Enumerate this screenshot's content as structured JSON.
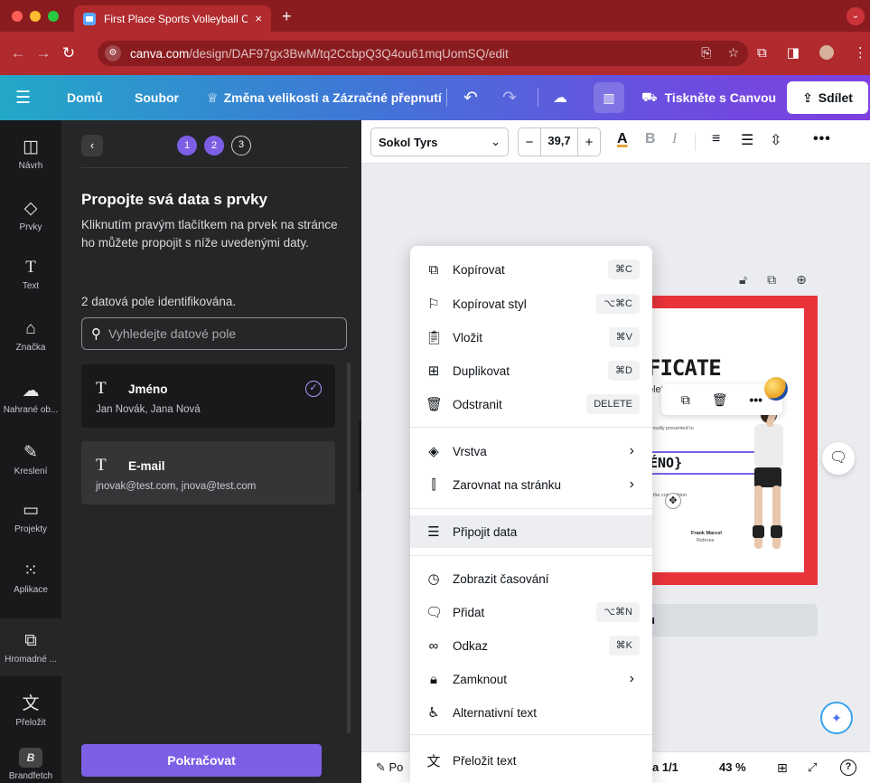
{
  "browser": {
    "tab_title": "First Place Sports Volleyball C",
    "tab_close": "×",
    "new_tab": "+",
    "url_host": "canva.com",
    "url_path": "/design/DAF97gx3BwM/tq2CcbpQ3Q4ou61mqUomSQ/edit"
  },
  "header": {
    "home": "Domů",
    "file": "Soubor",
    "resize": "Změna velikosti a Zázračné přepnutí",
    "print": "Tiskněte s Canvou",
    "share": "Sdílet"
  },
  "rail": [
    {
      "label": "Návrh",
      "icon": "layout-icon"
    },
    {
      "label": "Prvky",
      "icon": "shapes-icon"
    },
    {
      "label": "Text",
      "icon": "text-icon"
    },
    {
      "label": "Značka",
      "icon": "brand-icon"
    },
    {
      "label": "Nahrané ob...",
      "icon": "upload-icon"
    },
    {
      "label": "Kreslení",
      "icon": "draw-icon"
    },
    {
      "label": "Projekty",
      "icon": "folder-icon"
    },
    {
      "label": "Aplikace",
      "icon": "apps-icon"
    },
    {
      "label": "Hromadné ...",
      "icon": "bulk-create-icon"
    },
    {
      "label": "Přeložit",
      "icon": "translate-icon"
    },
    {
      "label": "Brandfetch",
      "icon": "brandfetch-icon"
    }
  ],
  "panel": {
    "steps": [
      "1",
      "2",
      "3"
    ],
    "title": "Propojte svá data s prvky",
    "description": "Kliknutím pravým tlačítkem na prvek na stránce ho můžete propojit s níže uvedenými daty.",
    "count": "2 datová pole identifikována.",
    "search_placeholder": "Vyhledejte datové pole",
    "fields": [
      {
        "name": "Jméno",
        "values": "Jan Novák, Jana Nová"
      },
      {
        "name": "E-mail",
        "values": "jnovak@test.com, jnova@test.com"
      }
    ],
    "continue": "Pokračovat"
  },
  "toolbar": {
    "font": "Sokol Tyrs",
    "font_size": "39,7",
    "minus": "−",
    "plus": "+"
  },
  "canvas": {
    "cert_title": "FICATE",
    "cert_sub": "pletion",
    "presented": "Proudly presented to",
    "name_field": "ÉNO}",
    "competition": "in the competition",
    "signer": "Frank Marcel",
    "signer_role": "Referee",
    "add_page": "u"
  },
  "status": {
    "notes": "Po",
    "page": "a 1/1",
    "zoom": "43 %"
  },
  "context_menu": [
    {
      "label": "Kopírovat",
      "shortcut": "⌘C",
      "icon": "copy-icon"
    },
    {
      "label": "Kopírovat styl",
      "shortcut": "⌥⌘C",
      "icon": "paint-roller-icon"
    },
    {
      "label": "Vložit",
      "shortcut": "⌘V",
      "icon": "clipboard-icon"
    },
    {
      "label": "Duplikovat",
      "shortcut": "⌘D",
      "icon": "duplicate-icon"
    },
    {
      "label": "Odstranit",
      "shortcut": "DELETE",
      "icon": "trash-icon"
    },
    {
      "label": "Vrstva",
      "shortcut": "",
      "icon": "layers-icon"
    },
    {
      "label": "Zarovnat na stránku",
      "shortcut": "",
      "icon": "align-icon"
    },
    {
      "label": "Připojit data",
      "shortcut": "",
      "icon": "database-icon"
    },
    {
      "label": "Zobrazit časování",
      "shortcut": "",
      "icon": "clock-icon"
    },
    {
      "label": "Přidat",
      "shortcut": "⌥⌘N",
      "icon": "comment-add-icon"
    },
    {
      "label": "Odkaz",
      "shortcut": "⌘K",
      "icon": "link-icon"
    },
    {
      "label": "Zamknout",
      "shortcut": "",
      "icon": "lock-icon"
    },
    {
      "label": "Alternativní text",
      "shortcut": "",
      "icon": "accessibility-icon"
    },
    {
      "label": "Přeložit text",
      "shortcut": "",
      "icon": "translate-icon"
    }
  ],
  "colors": {
    "browser_frame": "#b02a2e",
    "accent": "#7d5fe6",
    "certificate_red": "#e8333a"
  }
}
